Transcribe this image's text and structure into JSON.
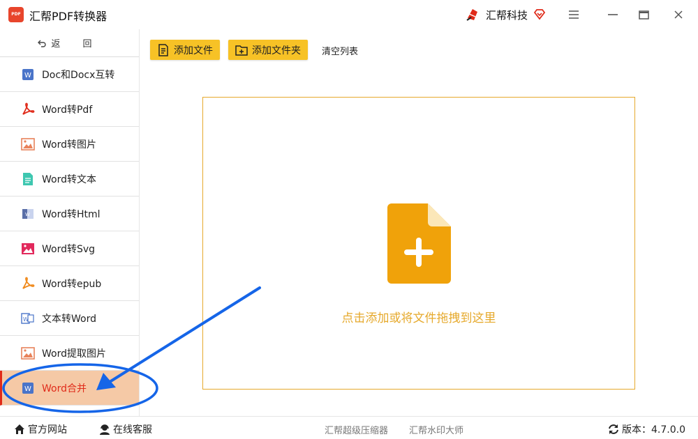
{
  "app": {
    "logo_text": "PDF",
    "title": "汇帮PDF转换器",
    "brand_name": "汇帮科技"
  },
  "colors": {
    "accent_yellow": "#f7c226",
    "active_bg": "#f5c9a6",
    "active_text": "#e02b1a",
    "drop_orange": "#e6a92c",
    "annotation_blue": "#1565e8"
  },
  "sidebar": {
    "back_label": "返 回",
    "items": [
      {
        "label": "Doc和Docx互转",
        "icon": "word-doc-icon"
      },
      {
        "label": "Word转Pdf",
        "icon": "pdf-icon"
      },
      {
        "label": "Word转图片",
        "icon": "image-icon"
      },
      {
        "label": "Word转文本",
        "icon": "text-file-icon"
      },
      {
        "label": "Word转Html",
        "icon": "html-icon"
      },
      {
        "label": "Word转Svg",
        "icon": "svg-image-icon"
      },
      {
        "label": "Word转epub",
        "icon": "epub-icon"
      },
      {
        "label": "文本转Word",
        "icon": "word-outline-icon"
      },
      {
        "label": "Word提取图片",
        "icon": "extract-image-icon"
      },
      {
        "label": "Word合并",
        "icon": "word-merge-icon",
        "active": true
      }
    ]
  },
  "toolbar": {
    "add_file": "添加文件",
    "add_folder": "添加文件夹",
    "clear_list": "清空列表"
  },
  "dropzone": {
    "text": "点击添加或将文件拖拽到这里",
    "icon": "add-file-icon"
  },
  "statusbar": {
    "website": "官方网站",
    "support": "在线客服",
    "compressor": "汇帮超级压缩器",
    "watermark": "汇帮水印大师",
    "version": "版本：4.7.0.0"
  }
}
